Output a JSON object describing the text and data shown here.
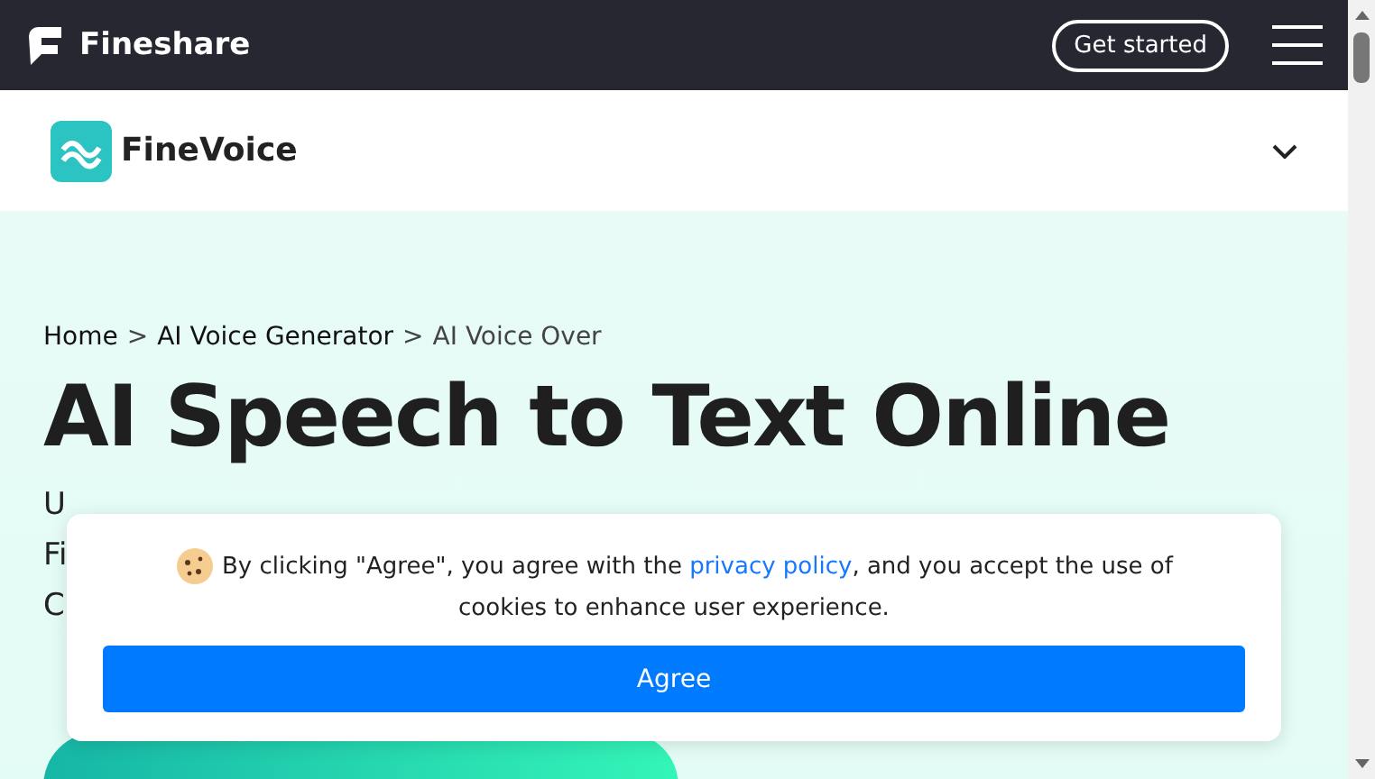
{
  "topbar": {
    "brand": "Fineshare",
    "cta": "Get started"
  },
  "subheader": {
    "product": "FineVoice"
  },
  "breadcrumb": [
    {
      "label": "Home",
      "link": true
    },
    {
      "label": ">",
      "link": false
    },
    {
      "label": "AI Voice Generator",
      "link": true
    },
    {
      "label": ">",
      "link": false
    },
    {
      "label": "AI Voice Over",
      "link": false
    }
  ],
  "title": "AI Speech to Text Online",
  "intro_lines": [
    "U",
    "Fi",
    "C"
  ],
  "cookie_banner": {
    "text_before": "By clicking \"Agree\", you agree with the",
    "link": "privacy policy",
    "text_after": ", and you accept the use of cookies to enhance user experience.",
    "button": "Agree"
  }
}
